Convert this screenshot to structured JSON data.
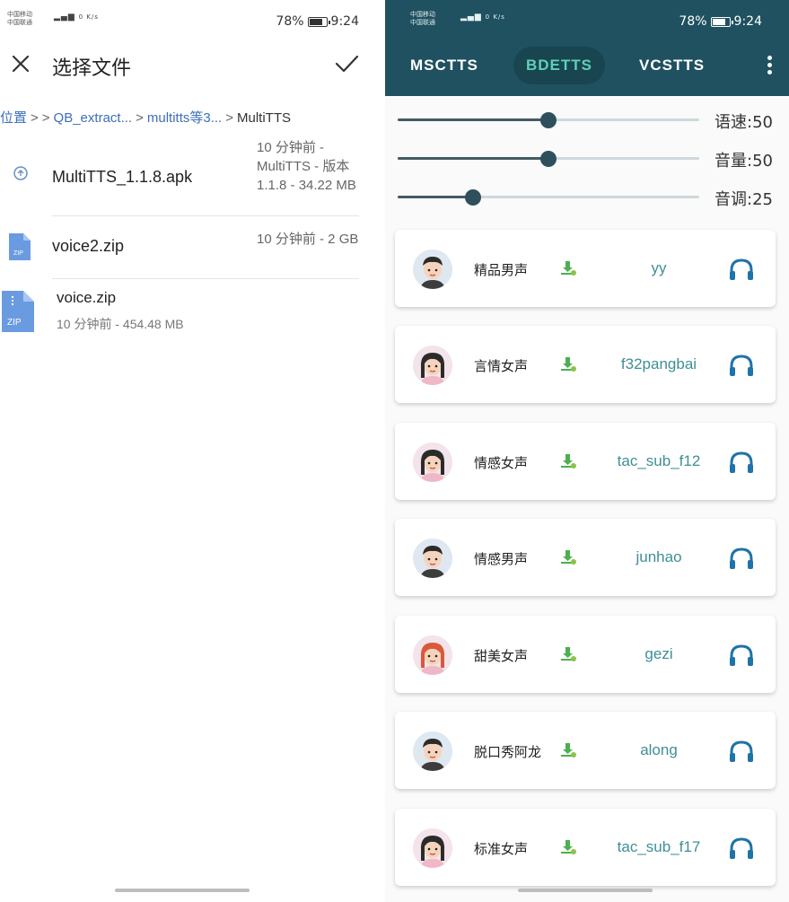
{
  "left": {
    "status_bar": {
      "carrier1": "中国移动",
      "carrier2": "中国联通",
      "net_speed": "0 K/s",
      "battery": "78%",
      "time": "9:24"
    },
    "toolbar": {
      "title": "选择文件"
    },
    "breadcrumbs": [
      "位置",
      "QB_extract...",
      "multitts等3...",
      "MultiTTS"
    ],
    "files": [
      {
        "name": "MultiTTS_1.1.8.apk",
        "meta": "10 分钟前 - MultiTTS - 版本 1.1.8 - 34.22 MB",
        "icon": "apk-icon"
      },
      {
        "name": "voice2.zip",
        "meta": "10 分钟前 - 2 GB",
        "icon": "zip-icon"
      },
      {
        "name": "voice.zip",
        "meta": "10 分钟前 - 454.48 MB",
        "icon": "zip-icon"
      }
    ],
    "zip_label": "ZIP"
  },
  "right": {
    "status_bar": {
      "carrier1": "中国移动",
      "carrier2": "中国联通",
      "net_speed": "0 K/s",
      "battery": "78%",
      "time": "9:24"
    },
    "tabs": [
      {
        "label": "MSCTTS",
        "active": false
      },
      {
        "label": "BDETTS",
        "active": true
      },
      {
        "label": "VCSTTS",
        "active": false
      }
    ],
    "sliders": [
      {
        "label": "语速:50",
        "value": 0.5
      },
      {
        "label": "音量:50",
        "value": 0.5
      },
      {
        "label": "音调:25",
        "value": 0.25
      }
    ],
    "voices": [
      {
        "name": "精品男声",
        "id": "yy",
        "gender": "male"
      },
      {
        "name": "言情女声",
        "id": "f32pangbai",
        "gender": "female"
      },
      {
        "name": "情感女声",
        "id": "tac_sub_f12",
        "gender": "female"
      },
      {
        "name": "情感男声",
        "id": "junhao",
        "gender": "male"
      },
      {
        "name": "甜美女声",
        "id": "gezi",
        "gender": "female"
      },
      {
        "name": "脱口秀阿龙",
        "id": "along",
        "gender": "male"
      },
      {
        "name": "标准女声",
        "id": "tac_sub_f17",
        "gender": "female"
      }
    ]
  },
  "colors": {
    "appbar": "#1f5160",
    "tab_active_text": "#5fd0b8",
    "voice_id": "#3f8f96",
    "link": "#3d6fb8",
    "headphone": "#1f73a8",
    "download": "#4caf50"
  }
}
